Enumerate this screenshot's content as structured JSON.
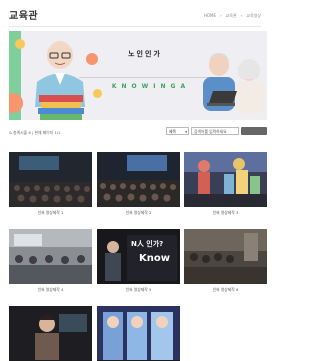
{
  "header": {
    "title": "교육관",
    "breadcrumb": [
      "HOME",
      "교육관",
      "교육영상"
    ]
  },
  "banner": {
    "title": "노인인가",
    "subtitle": "KNOWINGA"
  },
  "toolbar": {
    "info": "& 총게시물 6 | 현재 페이지 1/1",
    "category_value": "제목",
    "search_placeholder": "검색어를 입력하세요",
    "search_button_label": ""
  },
  "videos": [
    {
      "caption": "인싸 영상제작 1"
    },
    {
      "caption": "인싸 영상제작 2"
    },
    {
      "caption": "인싸 영상제작 3"
    },
    {
      "caption": "인싸 영상제작 4"
    },
    {
      "caption": "인싸 영상제작 5"
    },
    {
      "caption": "인싸 영상제작 6"
    },
    {
      "caption": ""
    },
    {
      "caption": ""
    }
  ],
  "thumb_text": {
    "line1": "N人 인가?",
    "line2": "Know"
  },
  "colors": {
    "accent_green": "#3aa35f",
    "banner_bg": "#efeef3",
    "coral": "#f7956e",
    "yellow": "#f8c85a"
  }
}
